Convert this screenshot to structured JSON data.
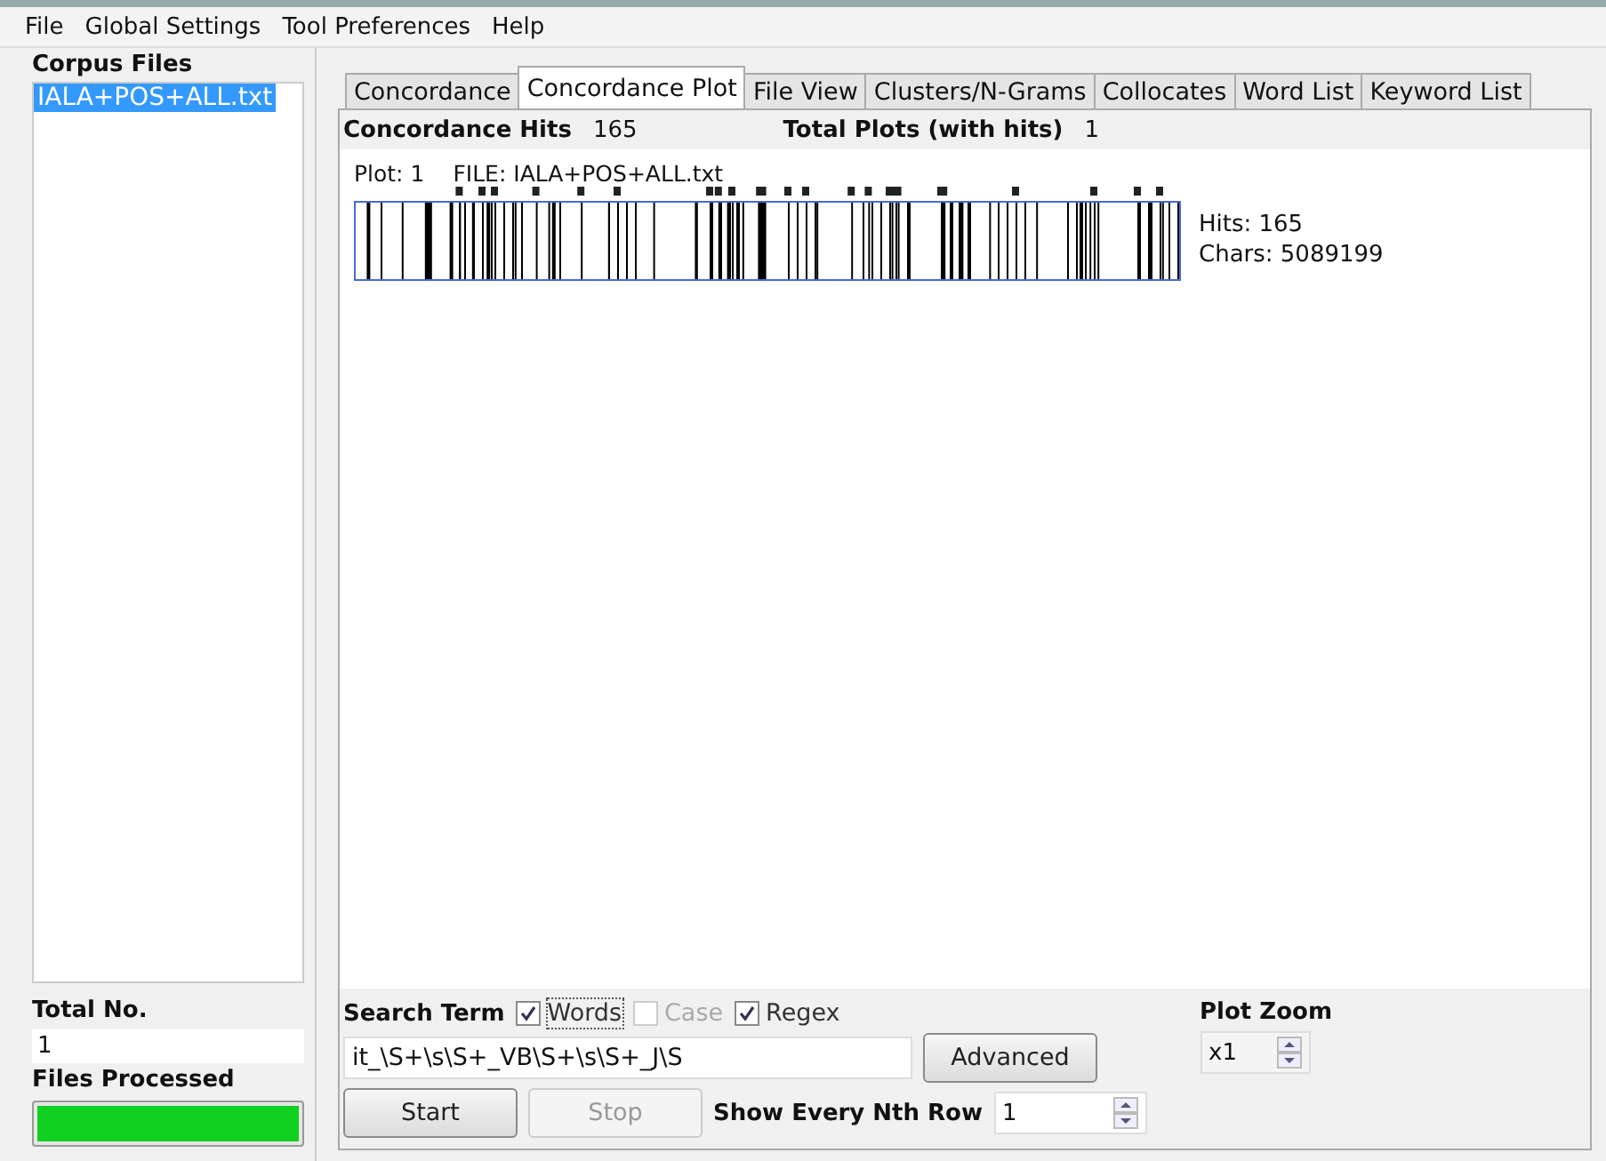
{
  "menu": [
    "File",
    "Global Settings",
    "Tool Preferences",
    "Help"
  ],
  "sidebar": {
    "title": "Corpus Files",
    "files": [
      {
        "name": "IALA+POS+ALL.txt",
        "selected": true
      }
    ],
    "total_label": "Total No.",
    "total_value": "1",
    "processed_label": "Files Processed",
    "progress": {
      "level": 1
    }
  },
  "tabs": [
    {
      "label": "Concordance",
      "selected": false
    },
    {
      "label": "Concordance Plot",
      "selected": true
    },
    {
      "label": "File View",
      "selected": false
    },
    {
      "label": "Clusters/N-Grams",
      "selected": false
    },
    {
      "label": "Collocates",
      "selected": false
    },
    {
      "label": "Word List",
      "selected": false
    },
    {
      "label": "Keyword List",
      "selected": false
    }
  ],
  "summary": {
    "hits_label": "Concordance Hits",
    "hits_value": "165",
    "plots_label": "Total Plots (with hits)",
    "plots_value": "1"
  },
  "plot": {
    "plot_label": "Plot: 1",
    "file_label": "FILE: IALA+POS+ALL.txt",
    "hits": "Hits: 165",
    "chars": "Chars: 5089199"
  },
  "search": {
    "label": "Search Term",
    "options": [
      {
        "label": "Words",
        "checked": true,
        "disabled": false,
        "focused": true
      },
      {
        "label": "Case",
        "checked": false,
        "disabled": true,
        "focused": false
      },
      {
        "label": "Regex",
        "checked": true,
        "disabled": false,
        "focused": false
      }
    ],
    "value": "it_\\S+\\s\\S+_VB\\S+\\s\\S+_J\\S",
    "advanced": "Advanced",
    "start": {
      "label": "Start",
      "disabled": false
    },
    "stop": {
      "label": "Stop",
      "disabled": true
    },
    "nth_label": "Show Every Nth Row",
    "nth_value": "1"
  },
  "zoom": {
    "label": "Plot Zoom",
    "value": "x1"
  }
}
